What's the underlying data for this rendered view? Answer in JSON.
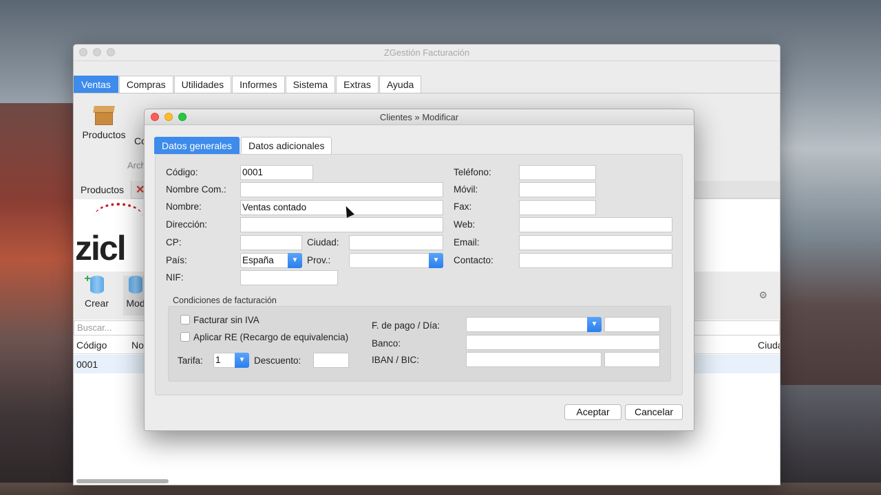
{
  "main_window": {
    "title": "ZGestión Facturación",
    "menu_tabs": [
      "Ventas",
      "Compras",
      "Utilidades",
      "Informes",
      "Sistema",
      "Extras",
      "Ayuda"
    ],
    "ribbon": {
      "productos_label": "Productos",
      "c_label": "Co",
      "group_label": "Arch"
    },
    "doc_tab": "Productos",
    "logo_text": "zicl",
    "toolbar": {
      "crear_label": "Crear",
      "modificar_label": "Mod"
    },
    "search_placeholder": "Buscar...",
    "grid": {
      "headers": [
        "Código",
        "No",
        "Ciuda"
      ],
      "rows": [
        [
          "0001"
        ]
      ]
    }
  },
  "dialog": {
    "title": "Clientes » Modificar",
    "tabs": [
      "Datos generales",
      "Datos adicionales"
    ],
    "fields": {
      "codigo": {
        "label": "Código:",
        "value": "0001"
      },
      "nombre_com": {
        "label": "Nombre Com.:",
        "value": ""
      },
      "nombre": {
        "label": "Nombre:",
        "value": "Ventas contado"
      },
      "direccion": {
        "label": "Dirección:",
        "value": ""
      },
      "cp": {
        "label": "CP:",
        "value": ""
      },
      "ciudad": {
        "label": "Ciudad:",
        "value": ""
      },
      "pais": {
        "label": "País:",
        "value": "España"
      },
      "prov": {
        "label": "Prov.:",
        "value": ""
      },
      "nif": {
        "label": "NIF:",
        "value": ""
      },
      "telefono": {
        "label": "Teléfono:",
        "value": ""
      },
      "movil": {
        "label": "Móvil:",
        "value": ""
      },
      "fax": {
        "label": "Fax:",
        "value": ""
      },
      "web": {
        "label": "Web:",
        "value": ""
      },
      "email": {
        "label": "Email:",
        "value": ""
      },
      "contacto": {
        "label": "Contacto:",
        "value": ""
      }
    },
    "condiciones": {
      "title": "Condiciones de facturación",
      "facturar_sin_iva": "Facturar sin IVA",
      "aplicar_re": "Aplicar RE (Recargo de equivalencia)",
      "tarifa_label": "Tarifa:",
      "tarifa_value": "1",
      "descuento_label": "Descuento:",
      "f_pago_label": "F. de pago / Día:",
      "banco_label": "Banco:",
      "iban_label": "IBAN / BIC:"
    },
    "buttons": {
      "accept": "Aceptar",
      "cancel": "Cancelar"
    }
  },
  "colors": {
    "accent": "#3d8bea",
    "close": "#fc5f57",
    "minimize": "#fdbc2e",
    "zoom": "#28c840"
  }
}
